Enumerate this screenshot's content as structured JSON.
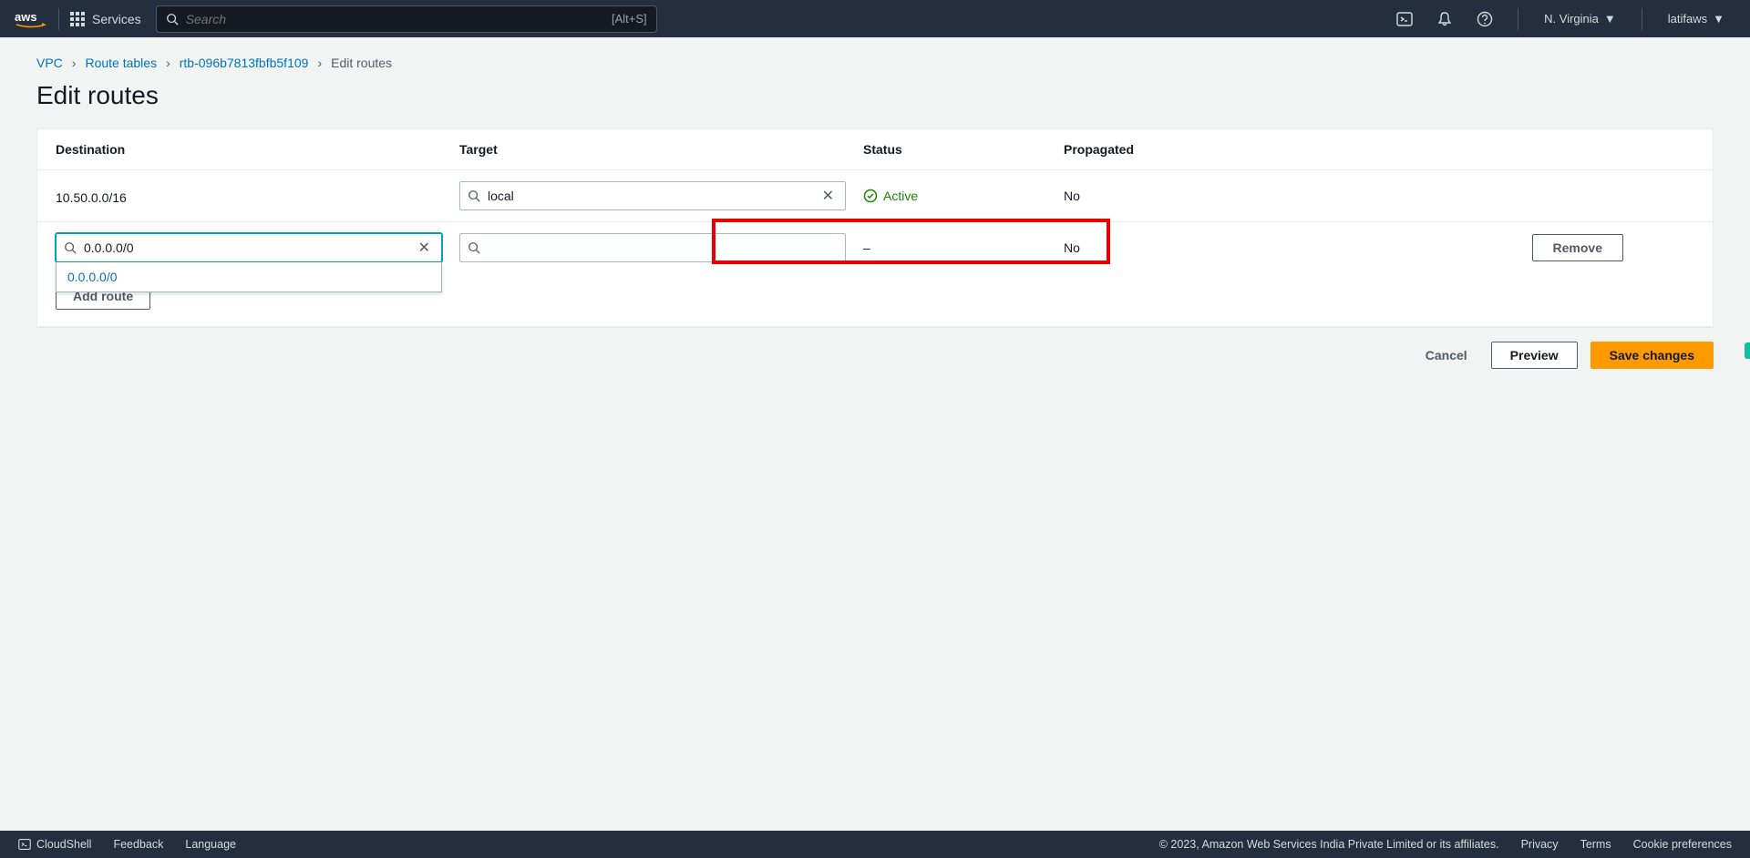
{
  "topnav": {
    "services_label": "Services",
    "search_placeholder": "Search",
    "search_shortcut": "[Alt+S]",
    "region": "N. Virginia",
    "user": "latifaws"
  },
  "breadcrumb": {
    "items": [
      "VPC",
      "Route tables",
      "rtb-096b7813fbfb5f109"
    ],
    "current": "Edit routes"
  },
  "page_title": "Edit routes",
  "table": {
    "headers": {
      "destination": "Destination",
      "target": "Target",
      "status": "Status",
      "propagated": "Propagated"
    },
    "rows": [
      {
        "destination": "10.50.0.0/16",
        "target": "local",
        "status": "Active",
        "propagated": "No"
      },
      {
        "destination_input": "0.0.0.0/0",
        "target_input": "",
        "status": "–",
        "propagated": "No",
        "remove_label": "Remove"
      }
    ],
    "dropdown_option": "0.0.0.0/0",
    "add_route_label": "Add route"
  },
  "footer": {
    "cancel": "Cancel",
    "preview": "Preview",
    "save": "Save changes"
  },
  "bottombar": {
    "cloudshell": "CloudShell",
    "feedback": "Feedback",
    "language": "Language",
    "copyright": "© 2023, Amazon Web Services India Private Limited or its affiliates.",
    "privacy": "Privacy",
    "terms": "Terms",
    "cookies": "Cookie preferences"
  }
}
